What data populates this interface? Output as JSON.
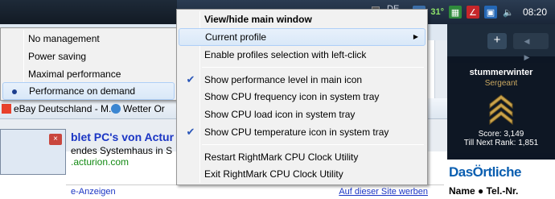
{
  "tray": {
    "temperature": "31°",
    "clock": "08:20",
    "hidden_label": "DE"
  },
  "gamer_card": {
    "username": "stummerwinter",
    "rank": "Sergeant",
    "score": "Score: 3,149",
    "next_rank": "Till Next Rank: 1,851",
    "plus_label": "+",
    "nav_arrows": "◀ ▶"
  },
  "ad_panel": {
    "logo": "DasÖrtliche",
    "columns": "Name ● Tel.-Nr."
  },
  "browser": {
    "bookmarks": [
      "eBay Deutschland - M...",
      "Wetter Or"
    ],
    "ad_title": "blet PC's von Actur",
    "ad_line2": "endes Systemhaus in S",
    "ad_line3": ".acturion.com",
    "ad_footer_left": "e-Anzeigen",
    "ad_footer_right": "Auf dieser Site werben",
    "popup_close": "×"
  },
  "main_menu": {
    "items": [
      {
        "label": "View/hide main window",
        "bold": true
      },
      {
        "label": "Current profile",
        "submenu": true
      },
      {
        "label": "Enable profiles selection with left-click"
      },
      {
        "label": "Show performance level in main icon",
        "checked": true
      },
      {
        "label": "Show CPU frequency icon in system tray"
      },
      {
        "label": "Show CPU load icon in system tray"
      },
      {
        "label": "Show CPU temperature icon in system tray",
        "checked": true
      },
      {
        "label": "Restart  RightMark CPU Clock Utility"
      },
      {
        "label": "Exit RightMark CPU Clock Utility"
      }
    ]
  },
  "profile_menu": {
    "items": [
      {
        "label": "No management"
      },
      {
        "label": "Power saving"
      },
      {
        "label": "Maximal performance"
      },
      {
        "label": "Performance on demand",
        "selected": true
      }
    ]
  },
  "glyphs": {
    "check": "✔",
    "submenu_arrow": "▶"
  }
}
